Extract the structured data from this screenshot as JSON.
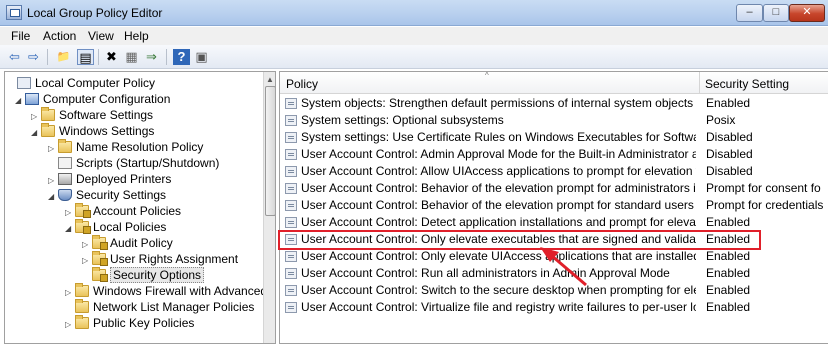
{
  "window": {
    "title": "Local Group Policy Editor",
    "min": "–",
    "max": "□",
    "close": "✕"
  },
  "menu": [
    "File",
    "Action",
    "View",
    "Help"
  ],
  "toolbar": {
    "back": "⇦",
    "forward": "⇨",
    "up": "📁",
    "show": "▤",
    "delete": "✖",
    "props": "▦",
    "export": "⇒",
    "help": "?",
    "view": "▣"
  },
  "tree": [
    {
      "label": "Local Computer Policy",
      "icon": "policy-icon",
      "arrow": ""
    },
    {
      "label": "Computer Configuration",
      "icon": "computer-icon",
      "arrow": "◢"
    },
    {
      "label": "Software Settings",
      "icon": "folder-icon",
      "arrow": "▷"
    },
    {
      "label": "Windows Settings",
      "icon": "folder-icon",
      "arrow": "◢"
    },
    {
      "label": "Name Resolution Policy",
      "icon": "folder-icon",
      "arrow": "▷"
    },
    {
      "label": "Scripts (Startup/Shutdown)",
      "icon": "scripts-icon",
      "arrow": ""
    },
    {
      "label": "Deployed Printers",
      "icon": "printer-icon",
      "arrow": "▷"
    },
    {
      "label": "Security Settings",
      "icon": "shield-icon",
      "arrow": "◢"
    },
    {
      "label": "Account Policies",
      "icon": "lock-folder-icon",
      "arrow": "▷"
    },
    {
      "label": "Local Policies",
      "icon": "lock-folder-icon",
      "arrow": "◢"
    },
    {
      "label": "Audit Policy",
      "icon": "lock-folder-icon",
      "arrow": "▷"
    },
    {
      "label": "User Rights Assignment",
      "icon": "lock-folder-icon",
      "arrow": "▷"
    },
    {
      "label": "Security Options",
      "icon": "lock-folder-icon",
      "arrow": ""
    },
    {
      "label": "Windows Firewall with Advanced S",
      "icon": "folder-icon",
      "arrow": "▷"
    },
    {
      "label": "Network List Manager Policies",
      "icon": "folder-icon",
      "arrow": ""
    },
    {
      "label": "Public Key Policies",
      "icon": "folder-icon",
      "arrow": "▷"
    }
  ],
  "columns": {
    "policy": "Policy",
    "setting": "Security Setting"
  },
  "rows": [
    {
      "policy": "System objects: Strengthen default permissions of internal system objects (e.g. Sy...",
      "setting": "Enabled"
    },
    {
      "policy": "System settings: Optional subsystems",
      "setting": "Posix"
    },
    {
      "policy": "System settings: Use Certificate Rules on Windows Executables for Software Restrict...",
      "setting": "Disabled"
    },
    {
      "policy": "User Account Control: Admin Approval Mode for the Built-in Administrator account",
      "setting": "Disabled"
    },
    {
      "policy": "User Account Control: Allow UIAccess applications to prompt for elevation without...",
      "setting": "Disabled"
    },
    {
      "policy": "User Account Control: Behavior of the elevation prompt for administrators in Admi...",
      "setting": "Prompt for consent fo"
    },
    {
      "policy": "User Account Control: Behavior of the elevation prompt for standard users",
      "setting": "Prompt for credentials"
    },
    {
      "policy": "User Account Control: Detect application installations and prompt for elevation",
      "setting": "Enabled"
    },
    {
      "policy": "User Account Control: Only elevate executables that are signed and validated",
      "setting": "Enabled"
    },
    {
      "policy": "User Account Control: Only elevate UIAccess applications that are installed in secur...",
      "setting": "Enabled"
    },
    {
      "policy": "User Account Control: Run all administrators in Admin Approval Mode",
      "setting": "Enabled"
    },
    {
      "policy": "User Account Control: Switch to the secure desktop when prompting for elevation",
      "setting": "Enabled"
    },
    {
      "policy": "User Account Control: Virtualize file and registry write failures to per-user locations",
      "setting": "Enabled"
    }
  ],
  "annotation_color": "#e0202a"
}
